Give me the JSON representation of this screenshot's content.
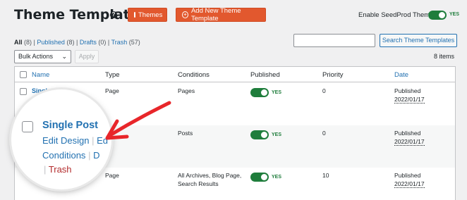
{
  "header": {
    "title": "Theme Templates",
    "help_glyph": "?",
    "themes_button": "Themes",
    "add_button": "Add New Theme Template",
    "enable_label": "Enable SeedProd Theme",
    "enable_state": "YES"
  },
  "filters": {
    "all_label": "All",
    "all_count": "(8)",
    "published_label": "Published",
    "published_count": "(8)",
    "drafts_label": "Drafts",
    "drafts_count": "(0)",
    "trash_label": "Trash",
    "trash_count": "(57)",
    "separator": "|"
  },
  "search": {
    "button_label": "Search Theme Templates"
  },
  "bulk": {
    "selected": "Bulk Actions",
    "apply_label": "Apply"
  },
  "items_count": "8 items",
  "table": {
    "columns": [
      "Name",
      "Type",
      "Conditions",
      "Published",
      "Priority",
      "Date"
    ],
    "rows": [
      {
        "name": "Single Page",
        "type": "Page",
        "conditions": "Pages",
        "published": "YES",
        "priority": "0",
        "date_status": "Published",
        "date": "2022/01/17"
      },
      {
        "name": "",
        "type": "",
        "conditions": "Posts",
        "published": "YES",
        "priority": "0",
        "date_status": "Published",
        "date": "2022/01/17"
      },
      {
        "name": "",
        "type": "Page",
        "conditions": "All Archives, Blog Page,",
        "conditions2": "Search Results",
        "published": "YES",
        "priority": "10",
        "date_status": "Published",
        "date": "2022/01/17"
      }
    ]
  },
  "magnifier": {
    "title": "Single Post",
    "edit_design": "Edit Design",
    "sep": "|",
    "edit_partial": "Ed",
    "conditions": "Conditions",
    "d_partial": "D",
    "trash": "Trash"
  },
  "colors": {
    "accent": "#e2582e",
    "link": "#2271b1",
    "toggle_on": "#1f7d3c",
    "annotation": "#e8262a"
  }
}
